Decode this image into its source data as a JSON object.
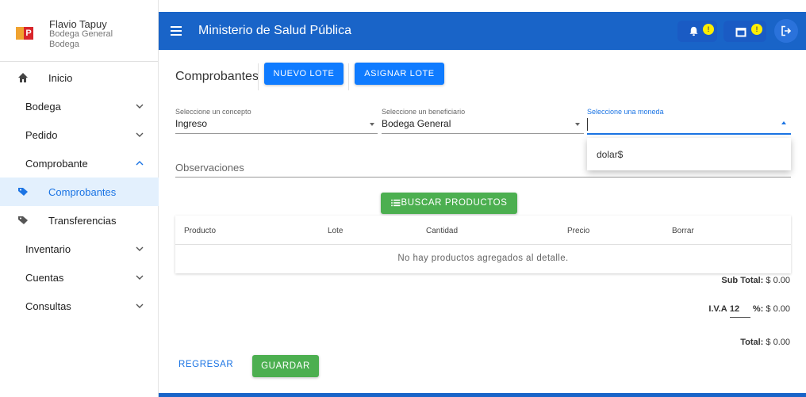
{
  "profile": {
    "name": "Flavio Tapuy",
    "role": "Bodega General",
    "location": "Bodega"
  },
  "sidebar": {
    "items": [
      {
        "label": "Inicio",
        "icon": "home-icon"
      },
      {
        "label": "Bodega",
        "icon": "chevron-down-icon"
      },
      {
        "label": "Pedido",
        "icon": "chevron-down-icon"
      },
      {
        "label": "Comprobante",
        "icon": "chevron-up-icon"
      },
      {
        "label": "Comprobantes",
        "icon": "tag-icon",
        "active": true
      },
      {
        "label": "Transferencias",
        "icon": "tag-icon"
      },
      {
        "label": "Inventario",
        "icon": "chevron-down-icon"
      },
      {
        "label": "Cuentas",
        "icon": "chevron-down-icon"
      },
      {
        "label": "Consultas",
        "icon": "chevron-down-icon"
      }
    ]
  },
  "header": {
    "title": "Ministerio de Salud Pública",
    "notification_badge": "!",
    "calendar_badge": "!"
  },
  "main": {
    "title": "Comprobantes",
    "new_lot_label": "NUEVO LOTE",
    "assign_lot_label": "ASIGNAR LOTE",
    "concept": {
      "label": "Seleccione un concepto",
      "value": "Ingreso"
    },
    "beneficiary": {
      "label": "Seleccione un beneficiario",
      "value": "Bodega General"
    },
    "currency": {
      "label": "Seleccione una moneda",
      "value": "",
      "options": [
        "dolar$"
      ]
    },
    "observations_label": "Observaciones",
    "search_products_label": "BUSCAR PRODUCTOS",
    "table": {
      "headers": [
        "Producto",
        "Lote",
        "Cantidad",
        "Precio",
        "Borrar"
      ],
      "empty_message": "No hay productos agregados al detalle."
    },
    "totals": {
      "subtotal_label": "Sub Total:",
      "subtotal_value": "$ 0.00",
      "iva_label": "I.V.A",
      "iva_rate": "12",
      "iva_suffix": "%:",
      "iva_value": "$ 0.00",
      "total_label": "Total:",
      "total_value": "$ 0.00"
    },
    "back_label": "REGRESAR",
    "save_label": "GUARDAR"
  },
  "colors": {
    "primary": "#1964c8",
    "accent_blue": "#0f7bff",
    "success": "#4caf50",
    "badge": "#ffee00"
  }
}
